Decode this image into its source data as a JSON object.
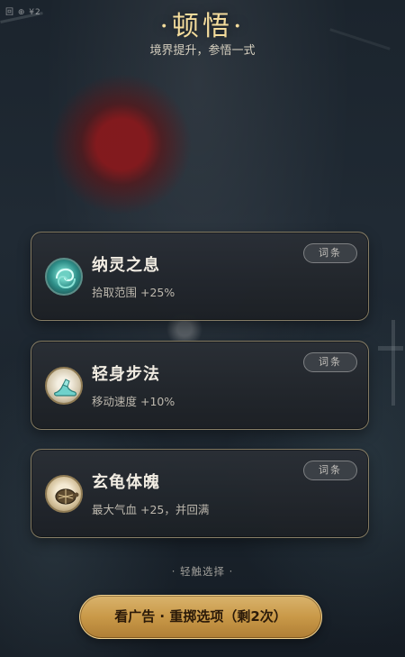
{
  "status_bar": {
    "left_text": "回 ⊕ ¥2"
  },
  "header": {
    "title": "·顿悟·",
    "subtitle": "境界提升，参悟一式"
  },
  "options": [
    {
      "name": "纳灵之息",
      "desc": "拾取范围 +25%",
      "tag": "词条",
      "icon": "spirit-breath-icon"
    },
    {
      "name": "轻身步法",
      "desc": "移动速度 +10%",
      "tag": "词条",
      "icon": "light-step-boot-icon"
    },
    {
      "name": "玄龟体魄",
      "desc": "最大气血 +25，并回满",
      "tag": "词条",
      "icon": "tortoise-shell-icon"
    }
  ],
  "hint": "· 轻触选择 ·",
  "reroll_button": {
    "label": "看广告 · 重掷选项（剩2次）"
  },
  "colors": {
    "title": "#f4dc9c",
    "card_border": "#d6c18f",
    "reroll_gold": "#c99948"
  }
}
